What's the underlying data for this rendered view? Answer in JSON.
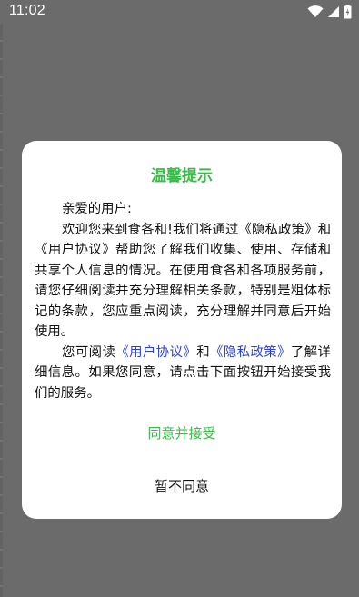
{
  "status_bar": {
    "time": "11:02",
    "icons": [
      "wifi-icon",
      "signal-icon",
      "battery-icon"
    ]
  },
  "dialog": {
    "title": "温馨提示",
    "greeting": "亲爱的用户:",
    "para1": "欢迎您来到食各和!我们将通过《隐私政策》和《用户协议》帮助您了解我们收集、使用、存储和共享个人信息的情况。在使用食各和各项服务前，请您仔细阅读并充分理解相关条款，特别是粗体标记的条款，您应重点阅读，充分理解并同意后开始使用。",
    "para2_prefix": "您可阅读",
    "user_agreement_link": "《用户协议》",
    "para2_and": "和",
    "privacy_policy_link": "《隐私政策》",
    "para2_suffix": "了解详细信息。如果您同意，请点击下面按钮开始接受我们的服务。",
    "accept_label": "同意并接受",
    "decline_label": "暂不同意"
  },
  "colors": {
    "overlay": "#6b6b6b",
    "accent_green": "#3dbb4a",
    "link_blue": "#2a3fd6",
    "dialog_bg": "#ffffff"
  }
}
